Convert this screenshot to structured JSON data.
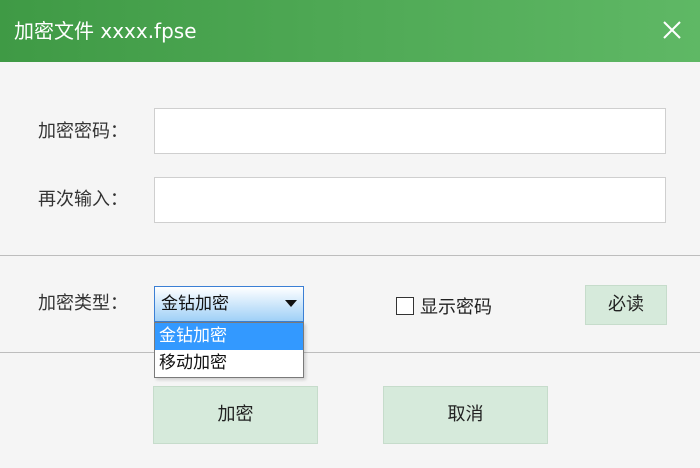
{
  "window": {
    "title": "加密文件 xxxx.fpse"
  },
  "form": {
    "password_label": "加密密码：",
    "password_value": "",
    "confirm_label": "再次输入：",
    "confirm_value": "",
    "type_label": "加密类型：",
    "type_selected": "金钻加密",
    "type_options": [
      "金钻加密",
      "移动加密"
    ],
    "show_password_label": "显示密码",
    "show_password_checked": false,
    "must_read_label": "必读"
  },
  "actions": {
    "encrypt_label": "加密",
    "cancel_label": "取消"
  },
  "colors": {
    "titlebar_start": "#3f9a45",
    "titlebar_end": "#5fb865",
    "button_bg": "#d6eadb",
    "selection": "#3399ff"
  },
  "icons": {
    "close": "close-icon",
    "dropdown": "chevron-down-icon"
  }
}
